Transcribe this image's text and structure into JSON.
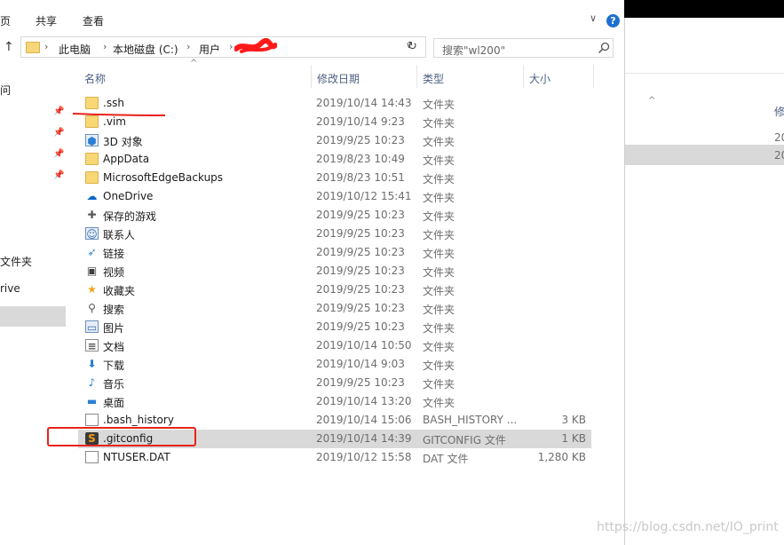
{
  "ribbon": {
    "tabs": [
      "页",
      "共享",
      "查看"
    ]
  },
  "address": {
    "crumbs": [
      "此电脑",
      "本地磁盘 (C:)",
      "用户"
    ],
    "search_placeholder": "搜索\"wl200\""
  },
  "navpane": {
    "items": [
      "问",
      "文件夹",
      "rive"
    ]
  },
  "columns": {
    "name": "名称",
    "date": "修改日期",
    "type": "类型",
    "size": "大小"
  },
  "files": [
    {
      "name": ".ssh",
      "date": "2019/10/14 14:43",
      "type": "文件夹",
      "size": "",
      "icon": "folder-icon"
    },
    {
      "name": ".vim",
      "date": "2019/10/14 9:23",
      "type": "文件夹",
      "size": "",
      "icon": "folder-icon"
    },
    {
      "name": "3D 对象",
      "date": "2019/9/25 10:23",
      "type": "文件夹",
      "size": "",
      "icon": "3d-objects-icon"
    },
    {
      "name": "AppData",
      "date": "2019/8/23 10:49",
      "type": "文件夹",
      "size": "",
      "icon": "folder-icon"
    },
    {
      "name": "MicrosoftEdgeBackups",
      "date": "2019/8/23 10:51",
      "type": "文件夹",
      "size": "",
      "icon": "folder-icon"
    },
    {
      "name": "OneDrive",
      "date": "2019/10/12 15:41",
      "type": "文件夹",
      "size": "",
      "icon": "onedrive-icon"
    },
    {
      "name": "保存的游戏",
      "date": "2019/9/25 10:23",
      "type": "文件夹",
      "size": "",
      "icon": "saved-games-icon"
    },
    {
      "name": "联系人",
      "date": "2019/9/25 10:23",
      "type": "文件夹",
      "size": "",
      "icon": "contacts-icon"
    },
    {
      "name": "链接",
      "date": "2019/9/25 10:23",
      "type": "文件夹",
      "size": "",
      "icon": "links-icon"
    },
    {
      "name": "视频",
      "date": "2019/9/25 10:23",
      "type": "文件夹",
      "size": "",
      "icon": "videos-icon"
    },
    {
      "name": "收藏夹",
      "date": "2019/9/25 10:23",
      "type": "文件夹",
      "size": "",
      "icon": "favorites-icon"
    },
    {
      "name": "搜索",
      "date": "2019/9/25 10:23",
      "type": "文件夹",
      "size": "",
      "icon": "searches-icon"
    },
    {
      "name": "图片",
      "date": "2019/9/25 10:23",
      "type": "文件夹",
      "size": "",
      "icon": "pictures-icon"
    },
    {
      "name": "文档",
      "date": "2019/10/14 10:50",
      "type": "文件夹",
      "size": "",
      "icon": "documents-icon"
    },
    {
      "name": "下载",
      "date": "2019/10/14 9:03",
      "type": "文件夹",
      "size": "",
      "icon": "downloads-icon"
    },
    {
      "name": "音乐",
      "date": "2019/9/25 10:23",
      "type": "文件夹",
      "size": "",
      "icon": "music-icon"
    },
    {
      "name": "桌面",
      "date": "2019/10/14 13:20",
      "type": "文件夹",
      "size": "",
      "icon": "desktop-icon"
    },
    {
      "name": ".bash_history",
      "date": "2019/10/14 15:06",
      "type": "BASH_HISTORY ...",
      "size": "3 KB",
      "icon": "file-icon"
    },
    {
      "name": ".gitconfig",
      "date": "2019/10/14 14:39",
      "type": "GITCONFIG 文件",
      "size": "1 KB",
      "icon": "sublime-file-icon"
    },
    {
      "name": "NTUSER.DAT",
      "date": "2019/10/12 15:58",
      "type": "DAT 文件",
      "size": "1,280 KB",
      "icon": "file-icon"
    }
  ],
  "selected_index": 18,
  "right_window": {
    "header": "修",
    "rows": [
      "20",
      "20"
    ]
  },
  "watermark": "https://blog.csdn.net/IO_print",
  "colors": {
    "annotation": "#e8221b",
    "selection": "#d9d9d9",
    "help": "#1e6fcf"
  }
}
